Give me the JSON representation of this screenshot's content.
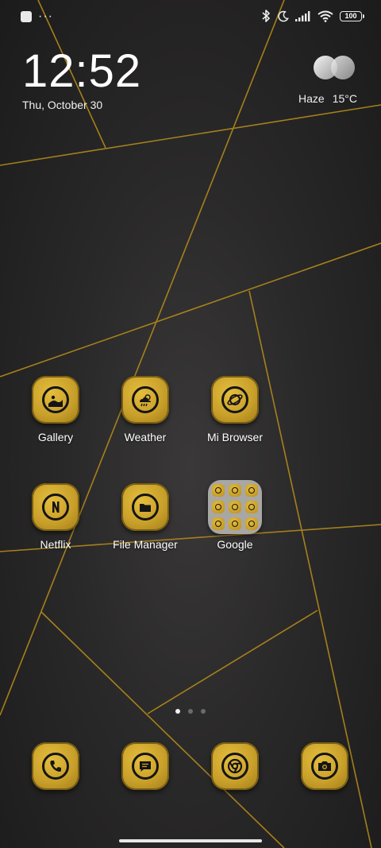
{
  "status_bar": {
    "battery_level": "100",
    "overflow_indicator": "···",
    "icons": [
      "notification-square-icon",
      "bluetooth-icon",
      "dnd-moon-icon",
      "signal-icon",
      "wifi-icon",
      "battery-icon"
    ]
  },
  "clock": {
    "time": "12:52",
    "date": "Thu, October 30"
  },
  "weather": {
    "condition": "Haze",
    "temperature": "15°C",
    "icon": "haze-icon"
  },
  "apps": [
    {
      "label": "Gallery",
      "icon": "gallery-icon"
    },
    {
      "label": "Weather",
      "icon": "weather-icon"
    },
    {
      "label": "Mi Browser",
      "icon": "browser-icon"
    },
    {
      "label": "Netflix",
      "icon": "netflix-icon"
    },
    {
      "label": "File Manager",
      "icon": "folder-icon"
    }
  ],
  "folder": {
    "label": "Google",
    "app_count": 9
  },
  "dock": [
    {
      "icon": "phone-icon"
    },
    {
      "icon": "messages-icon"
    },
    {
      "icon": "chrome-icon"
    },
    {
      "icon": "camera-icon"
    }
  ],
  "pager": {
    "pages": 3,
    "current": 1
  },
  "theme": {
    "accent_gold": "#c9a02a",
    "wallpaper_dark": "#2a2929",
    "line_gold": "#b38a1c"
  }
}
